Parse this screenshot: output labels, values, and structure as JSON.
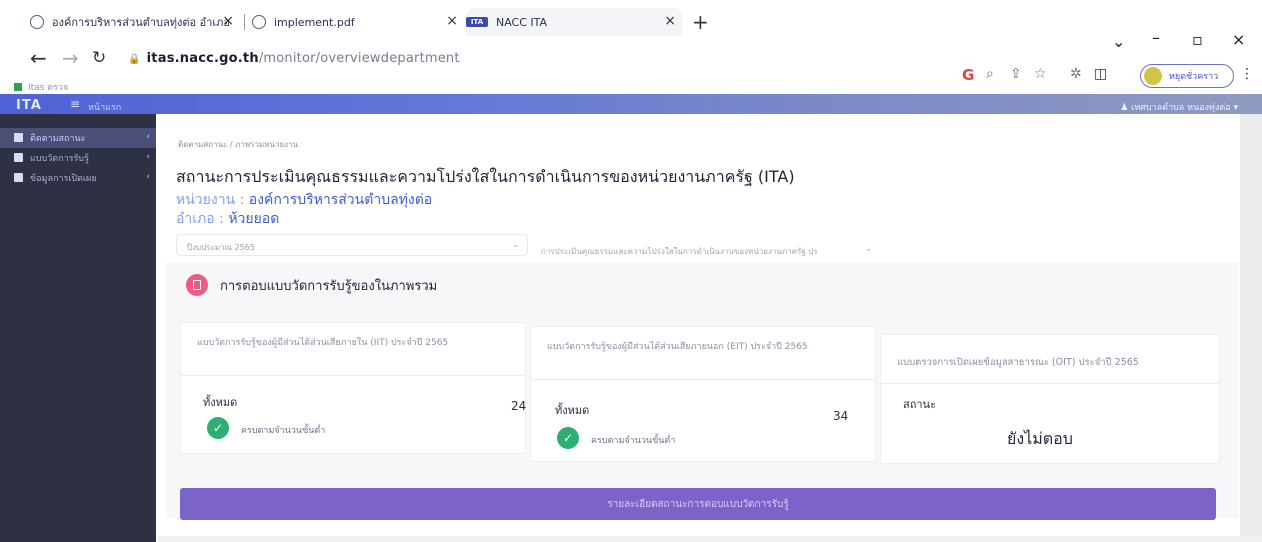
{
  "browser": {
    "tabs": [
      {
        "label": "องค์การบริหารส่วนตำบลทุ่งต่อ อำเภอ"
      },
      {
        "label": "implement.pdf"
      },
      {
        "label": "NACC ITA"
      }
    ],
    "url_host": "itas.nacc.go.th",
    "url_path": "/monitor/overviewdepartment",
    "bookmark": "Itas ตรวจ",
    "profile_label": "หยุดชั่วคราว"
  },
  "app": {
    "logo": "ITA",
    "home_label": "หน้าแรก",
    "user_label": "เทศบาลตำบล หนองทุ่งต่อ"
  },
  "sidebar": {
    "items": [
      {
        "label": "ติดตามสถานะ"
      },
      {
        "label": "แบบวัดการรับรู้"
      },
      {
        "label": "ข้อมูลการเปิดเผย"
      }
    ]
  },
  "main": {
    "breadcrumb": "ติดตามสถานะ / ภาพรวมหน่วยงาน",
    "title": "สถานะการประเมินคุณธรรมและความโปร่งใสในการดำเนินการของหน่วยงานภาครัฐ (ITA)",
    "unit_label": "หน่วยงาน :",
    "unit_value": "องค์การบริหารส่วนตำบลทุ่งต่อ",
    "district_label": "อำเภอ :",
    "district_value": "ห้วยยอด",
    "filter_year": "ปีงบประมาณ 2565",
    "filter_assessment": "การประเมินคุณธรรมและความโปร่งใสในการดำเนินงานของหน่วยงานภาครัฐ ปร",
    "section_title": "การตอบแบบวัดการรับรู้ของในภาพรวม",
    "cards": [
      {
        "header": "แบบวัดการรับรู้ของผู้มีส่วนได้ส่วนเสียภายใน (IIT) ประจำปี 2565",
        "total_label": "ทั้งหมด",
        "total_value": "24",
        "status_text": "ครบตามจำนวนขั้นต่ำ"
      },
      {
        "header": "แบบวัดการรับรู้ของผู้มีส่วนได้ส่วนเสียภายนอก (EIT) ประจำปี 2565",
        "total_label": "ทั้งหมด",
        "total_value": "34",
        "status_text": "ครบตามจำนวนขั้นต่ำ"
      },
      {
        "header": "แบบตรวจการเปิดเผยข้อมูลสาธารณะ (OIT) ประจำปี 2565",
        "status_label": "สถานะ",
        "status_value": "ยังไม่ตอบ"
      }
    ],
    "detail_button": "รายละเอียดสถานะการตอบแบบวัดการรับรู้"
  }
}
